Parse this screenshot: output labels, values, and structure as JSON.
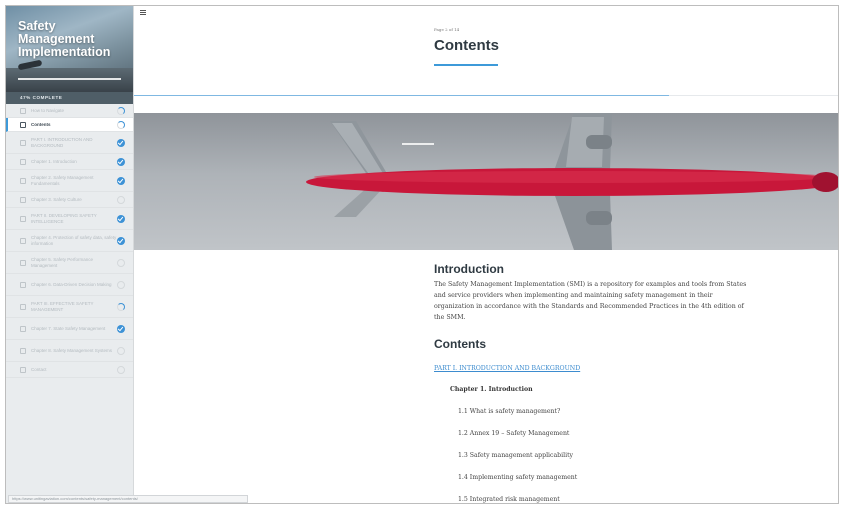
{
  "sidebar": {
    "title_line1": "Safety",
    "title_line2": "Management",
    "title_line3": "Implementation",
    "completion": "47% COMPLETE",
    "items": [
      {
        "label": "How to Navigate",
        "status": "partial"
      },
      {
        "label": "Contents",
        "status": "partial",
        "active": true
      },
      {
        "label": "PART I. INTRODUCTION AND BACKGROUND",
        "status": "done"
      },
      {
        "label": "Chapter 1. Introduction",
        "status": "done"
      },
      {
        "label": "Chapter 2. Safety Management Fundamentals",
        "status": "done"
      },
      {
        "label": "Chapter 3. Safety Culture",
        "status": "none"
      },
      {
        "label": "PART II. DEVELOPING SAFETY INTELLIGENCE",
        "status": "done"
      },
      {
        "label": "Chapter 4. Protection of safety data, safety information",
        "status": "done"
      },
      {
        "label": "Chapter 5. Safety Performance Management",
        "status": "none"
      },
      {
        "label": "Chapter 6. Data-Driven Decision Making",
        "status": "none"
      },
      {
        "label": "PART III. EFFECTIVE SAFETY MANAGEMENT",
        "status": "partial"
      },
      {
        "label": "Chapter 7. State Safety Management",
        "status": "done"
      },
      {
        "label": "Chapter 8. Safety Management Systems",
        "status": "none"
      },
      {
        "label": "Contact",
        "status": "none"
      }
    ]
  },
  "statusbar": {
    "url": "https://www.unitingaviation.com/contents/safety-management/contents/"
  },
  "header": {
    "page_number": "Page 2 of 14",
    "title": "Contents",
    "progress_fraction": 0.76
  },
  "main": {
    "intro_heading": "Introduction",
    "intro_text": "The Safety Management Implementation (SMI) is a repository for examples and tools from States and service providers when implementing and maintaining safety management in their organization in accordance with the Standards and Recommended Practices in the 4th edition of the SMM.",
    "contents_heading": "Contents",
    "part_link": "PART I. INTRODUCTION AND BACKGROUND",
    "chapter": "Chapter 1. Introduction",
    "sections": [
      "1.1 What is safety management?",
      "1.2 Annex 19 – Safety Management",
      "1.3 Safety management applicability",
      "1.4 Implementing safety management",
      "1.5 Integrated risk management"
    ]
  },
  "colors": {
    "accent": "#3d9ad9",
    "check": "#3d92d6",
    "plane_body": "#c8173a"
  },
  "icons": {
    "menu": "hamburger-menu-icon",
    "page": "page-icon",
    "status_done": "check-circle-icon",
    "status_partial": "partial-progress-icon",
    "status_none": "empty-circle-icon"
  }
}
